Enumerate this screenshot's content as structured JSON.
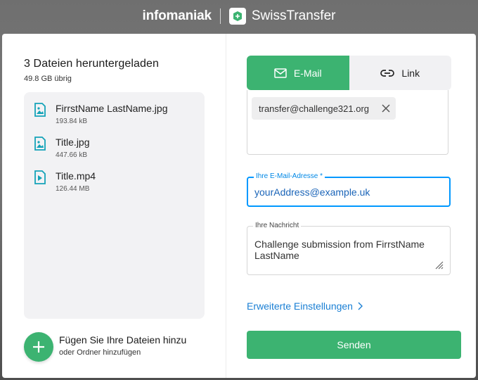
{
  "header": {
    "brand": "infomaniak",
    "product": "SwissTransfer"
  },
  "upload": {
    "title": "3 Dateien heruntergeladen",
    "remaining": "49.8 GB übrig",
    "files": [
      {
        "name": "FirrstName LastName.jpg",
        "size": "193.84 kB",
        "icon": "image-file-icon"
      },
      {
        "name": "Title.jpg",
        "size": "447.66 kB",
        "icon": "image-file-icon"
      },
      {
        "name": "Title.mp4",
        "size": "126.44 MB",
        "icon": "video-file-icon"
      }
    ],
    "add_label": "Fügen Sie Ihre Dateien hinzu",
    "add_sub": "oder Ordner hinzufügen"
  },
  "tabs": {
    "email": "E-Mail",
    "link": "Link"
  },
  "form": {
    "recipient": "transfer@challenge321.org",
    "email_label": "Ihre E-Mail-Adresse *",
    "email_value": "yourAddress@example.uk",
    "message_label": "Ihre Nachricht",
    "message_value": "Challenge submission from FirrstName LastName",
    "advanced": "Erweiterte Einstellungen",
    "send": "Senden"
  },
  "colors": {
    "accent": "#3cb371",
    "focus": "#0098ff",
    "link": "#1a7fd4"
  }
}
